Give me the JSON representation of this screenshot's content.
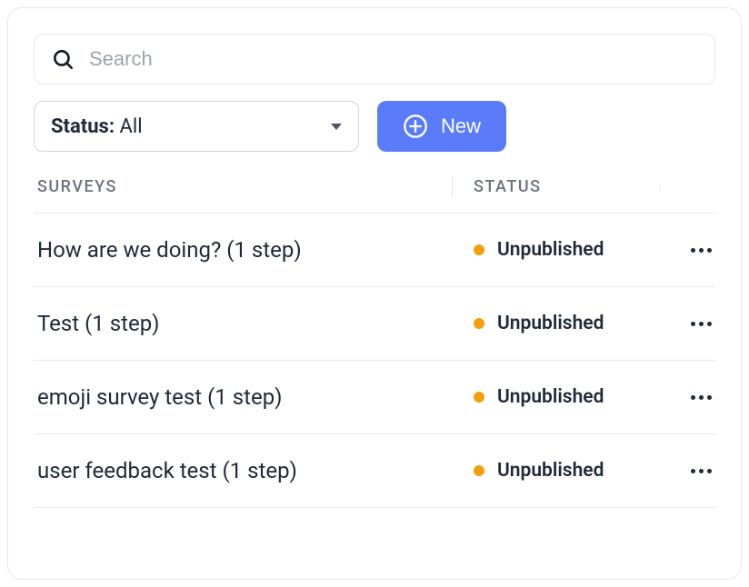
{
  "search": {
    "placeholder": "Search",
    "value": ""
  },
  "filter": {
    "label": "Status:",
    "value": "All"
  },
  "buttons": {
    "new_label": "New"
  },
  "columns": {
    "surveys": "SURVEYS",
    "status": "STATUS"
  },
  "status_colors": {
    "unpublished": "#f59e0b"
  },
  "surveys": [
    {
      "name": "How are we doing? (1 step)",
      "status": "Unpublished"
    },
    {
      "name": "Test (1 step)",
      "status": "Unpublished"
    },
    {
      "name": "emoji survey test (1 step)",
      "status": "Unpublished"
    },
    {
      "name": "user feedback test (1 step)",
      "status": "Unpublished"
    }
  ]
}
